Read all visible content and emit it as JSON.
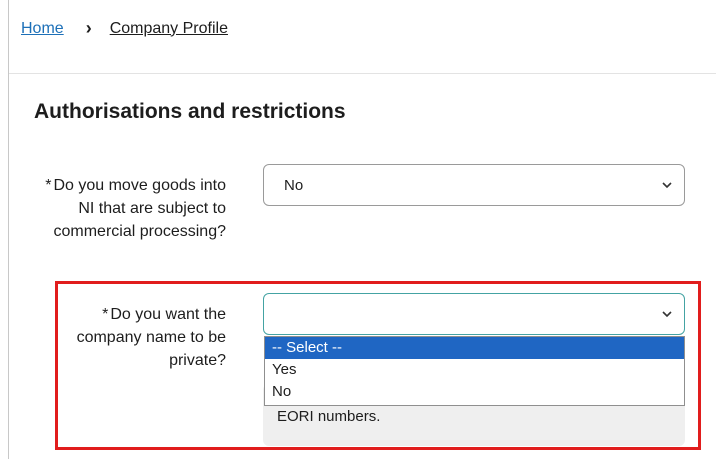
{
  "breadcrumb": {
    "home": "Home",
    "current": "Company Profile"
  },
  "section_title": "Authorisations and restrictions",
  "required_marker": "*",
  "question1": {
    "label": "Do you move goods into NI that are subject to commercial processing?",
    "value": "No"
  },
  "question2": {
    "label": "Do you want the company name to be private?",
    "value": ""
  },
  "dropdown_options": [
    "-- Select --",
    "Yes",
    "No"
  ],
  "hint_text": "EORI numbers.",
  "colors": {
    "link": "#1d70b8",
    "highlight_border": "#e11d1d",
    "option_selected": "#1f66c3"
  },
  "icons": {
    "select_arrow": "chevron-down-icon",
    "breadcrumb_separator": "chevron-right-icon"
  }
}
